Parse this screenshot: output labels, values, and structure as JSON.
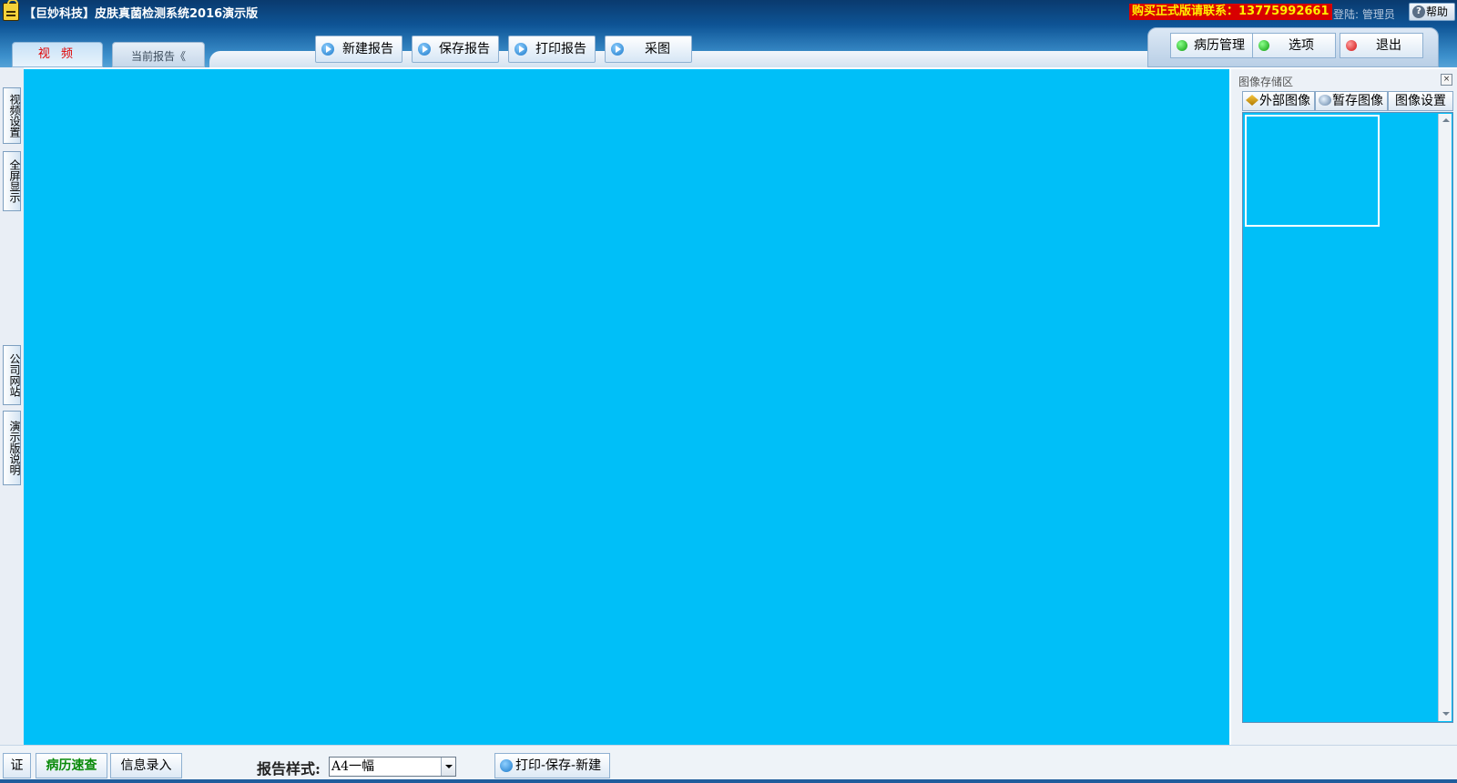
{
  "window": {
    "title": "【巨妙科技】皮肤真菌检测系统2016演示版",
    "buy_notice": "购买正式版请联系：13775992661",
    "login_text": "登陆: 管理员",
    "help_label": "帮助"
  },
  "tabs": [
    {
      "label": "视 频",
      "active": true
    },
    {
      "label": "当前报告《",
      "active": false
    }
  ],
  "toolbar": {
    "new_report": "新建报告",
    "save_report": "保存报告",
    "print_report": "打印报告",
    "capture": "采图"
  },
  "right_toolbar": {
    "records": "病历管理",
    "options": "选项",
    "exit": "退出"
  },
  "left_rail": {
    "video_settings": "视频设置",
    "fullscreen": "全屏显示",
    "company_site": "公司网站",
    "demo_info": "演示版说明"
  },
  "image_panel": {
    "title": "图像存储区",
    "close_icon": "×",
    "tabs": [
      "外部图像",
      "暂存图像",
      "图像设置"
    ]
  },
  "bottom": {
    "cert": "证",
    "quick_lookup": "病历速查",
    "info_entry": "信息录入",
    "style_label": "报告样式:",
    "style_value": "A4一幅",
    "print_save_new": "打印-保存-新建"
  },
  "colors": {
    "video_bg": "#00bff8",
    "title_bar": "#0e5698",
    "buy_bg": "#d80000",
    "buy_text": "#ffee00"
  }
}
